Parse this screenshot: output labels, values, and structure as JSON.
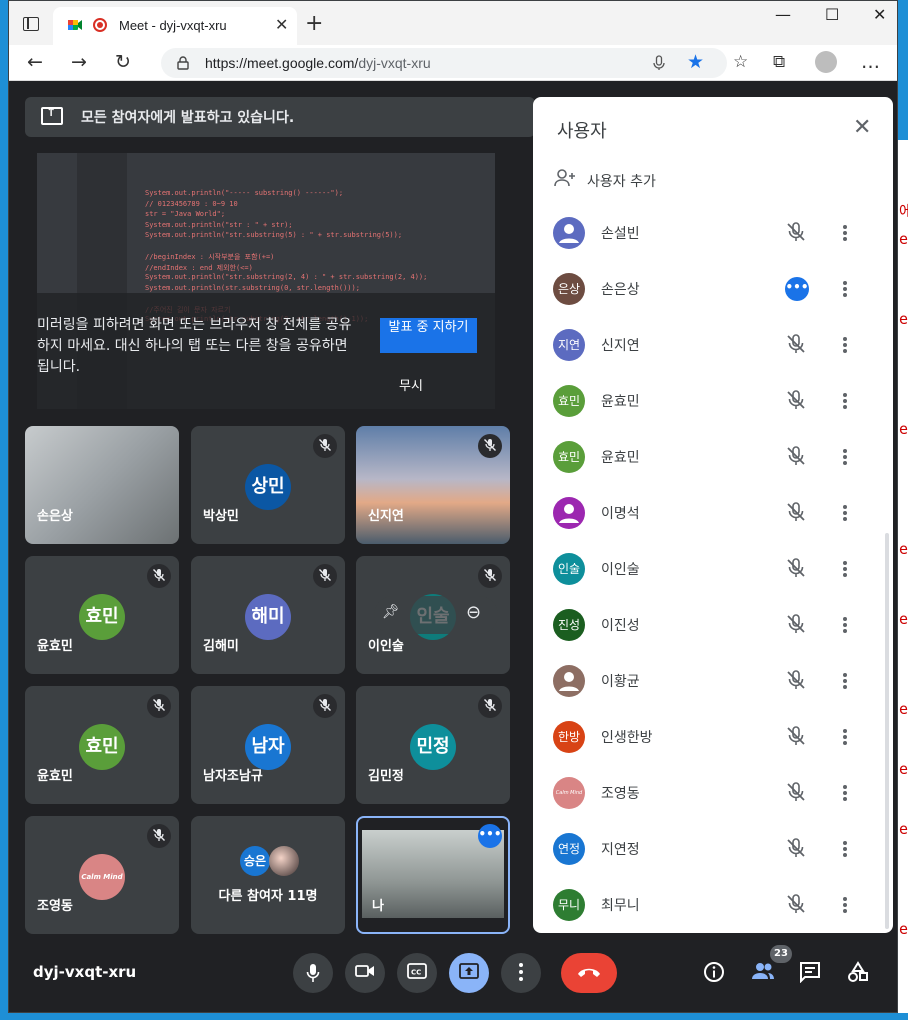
{
  "browser": {
    "tab_title": "Meet - dyj-vxqt-xru",
    "url_host": "https://meet.google.com/",
    "url_path": "dyj-vxqt-xru"
  },
  "banner": {
    "text": "모든 참여자에게 발표하고 있습니다."
  },
  "preview": {
    "message": "미러링을 피하려면 화면 또는 브라우저 창 전체를 공유하지 마세요. 대신 하나의 탭 또는 다른 창을 공유하면 됩니다.",
    "stop_label": "발표 중 지하기",
    "ignore_label": "무시",
    "code_lines": [
      "System.out.println(\"----- substring() ------\");",
      "//     0123456789 : 0~9 10",
      "str = \"Java World\";",
      "System.out.println(\"str : \" + str);",
      "System.out.println(\"str.substring(5) : \" + str.substring(5));",
      "",
      "//beginIndex : 시작부분을 포함(+=)",
      "//endIndex : end 제외한(<=)",
      "System.out.println(\"str.substring(2, 4) : \" + str.substring(2, 4));",
      "System.out.println(str.substring(0, str.length()));",
      "",
      "//주어진 길이 문자 자르기",
      "System.out.println(str.substring(0, str.length()-1));"
    ]
  },
  "tiles": [
    {
      "name": "손은상",
      "avatar": "",
      "color": "",
      "kind": "wall",
      "muted": false
    },
    {
      "name": "박상민",
      "avatar": "상민",
      "color": "#0b57a4",
      "kind": "avatar",
      "muted": true
    },
    {
      "name": "신지연",
      "avatar": "",
      "color": "",
      "kind": "sky",
      "muted": true
    },
    {
      "name": "윤효민",
      "avatar": "효민",
      "color": "#5a9e3a",
      "kind": "avatar",
      "muted": true
    },
    {
      "name": "김해미",
      "avatar": "해미",
      "color": "#5c6bc0",
      "kind": "avatar",
      "muted": true
    },
    {
      "name": "이인술",
      "avatar": "인술",
      "color": "#0e7c7b",
      "kind": "avatar",
      "muted": true
    },
    {
      "name": "윤효민",
      "avatar": "효민",
      "color": "#5a9e3a",
      "kind": "avatar",
      "muted": true
    },
    {
      "name": "남자조남규",
      "avatar": "남자",
      "color": "#1976d2",
      "kind": "avatar",
      "muted": true
    },
    {
      "name": "김민정",
      "avatar": "민정",
      "color": "#0e8f9b",
      "kind": "avatar",
      "muted": true
    },
    {
      "name": "조영동",
      "avatar": "Calm Mind",
      "color": "#d98585",
      "kind": "avatar",
      "muted": true
    },
    {
      "name": "다른 참여자 11명",
      "avatar": "승은",
      "color": "#1976d2",
      "kind": "others",
      "muted": false
    },
    {
      "name": "나",
      "avatar": "",
      "color": "",
      "kind": "me",
      "muted": false
    }
  ],
  "panel": {
    "title": "사용자",
    "add_user_label": "사용자 추가",
    "people": [
      {
        "name": "손설빈",
        "avatar": "",
        "color": "#5c6bc0",
        "state": "muted"
      },
      {
        "name": "손은상",
        "avatar": "은상",
        "color": "#6d4c41",
        "state": "active"
      },
      {
        "name": "신지연",
        "avatar": "지연",
        "color": "#5c6bc0",
        "state": "muted"
      },
      {
        "name": "윤효민",
        "avatar": "효민",
        "color": "#5a9e3a",
        "state": "muted"
      },
      {
        "name": "윤효민",
        "avatar": "효민",
        "color": "#5a9e3a",
        "state": "muted"
      },
      {
        "name": "이명석",
        "avatar": "",
        "color": "#9c27b0",
        "state": "muted"
      },
      {
        "name": "이인술",
        "avatar": "인술",
        "color": "#0e8f9b",
        "state": "muted"
      },
      {
        "name": "이진성",
        "avatar": "진성",
        "color": "#1b5e20",
        "state": "muted"
      },
      {
        "name": "이황균",
        "avatar": "",
        "color": "#8d6e63",
        "state": "muted"
      },
      {
        "name": "인생한방",
        "avatar": "한방",
        "color": "#d84315",
        "state": "muted"
      },
      {
        "name": "조영동",
        "avatar": "Calm Mind",
        "color": "#d98585",
        "state": "muted"
      },
      {
        "name": "지연정",
        "avatar": "연정",
        "color": "#1976d2",
        "state": "muted"
      },
      {
        "name": "최무니",
        "avatar": "무니",
        "color": "#2e7d32",
        "state": "muted"
      }
    ]
  },
  "bottom": {
    "meeting_code": "dyj-vxqt-xru",
    "people_count": "23"
  }
}
